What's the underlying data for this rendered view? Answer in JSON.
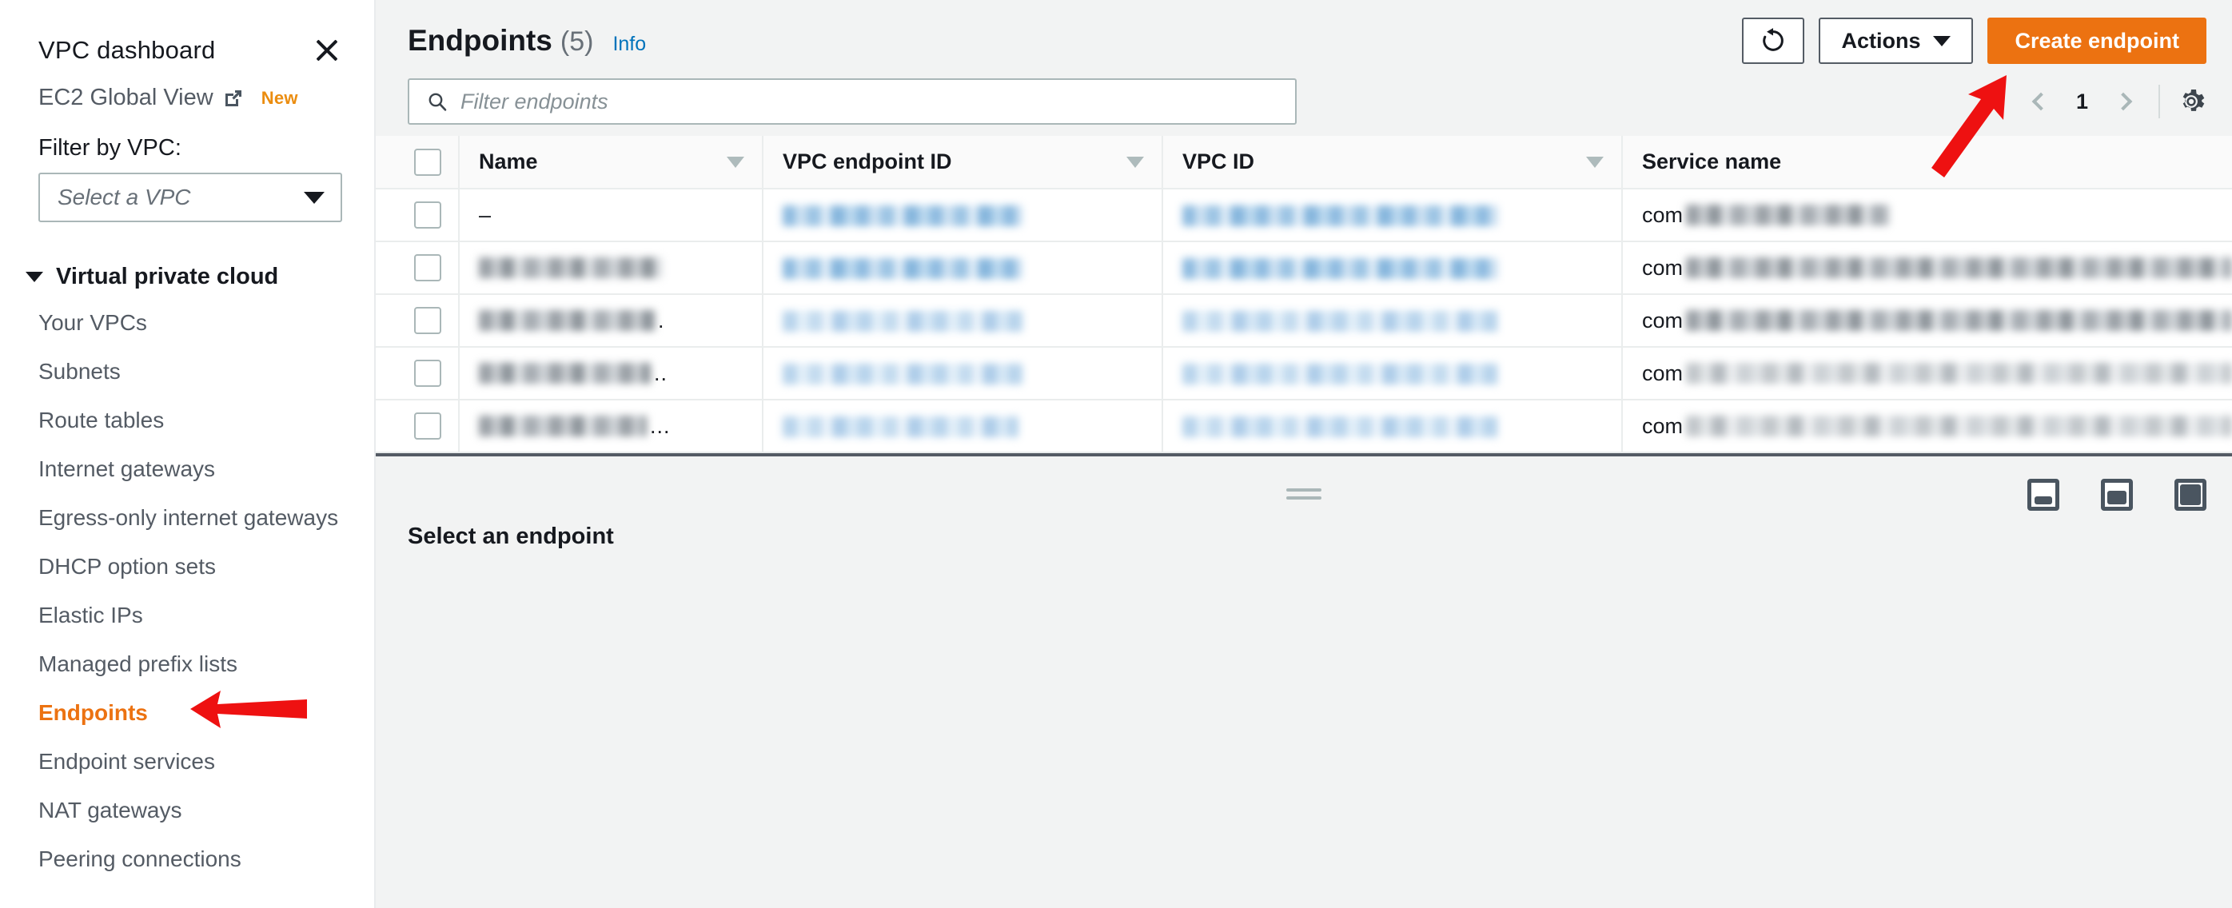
{
  "sidebar": {
    "title": "VPC dashboard",
    "close_icon": "close-icon",
    "global_view": {
      "label": "EC2 Global View",
      "external_icon": "external-link-icon",
      "badge": "New"
    },
    "filter_label": "Filter by VPC:",
    "vpc_select_placeholder": "Select a VPC",
    "group_label": "Virtual private cloud",
    "items": [
      {
        "label": "Your VPCs",
        "active": false
      },
      {
        "label": "Subnets",
        "active": false
      },
      {
        "label": "Route tables",
        "active": false
      },
      {
        "label": "Internet gateways",
        "active": false
      },
      {
        "label": "Egress-only internet gateways",
        "active": false
      },
      {
        "label": "DHCP option sets",
        "active": false
      },
      {
        "label": "Elastic IPs",
        "active": false
      },
      {
        "label": "Managed prefix lists",
        "active": false
      },
      {
        "label": "Endpoints",
        "active": true
      },
      {
        "label": "Endpoint services",
        "active": false
      },
      {
        "label": "NAT gateways",
        "active": false
      },
      {
        "label": "Peering connections",
        "active": false
      }
    ]
  },
  "header": {
    "title": "Endpoints",
    "count": "(5)",
    "info_link": "Info",
    "refresh_icon": "refresh-icon",
    "actions_label": "Actions",
    "create_label": "Create endpoint"
  },
  "search": {
    "icon": "search-icon",
    "placeholder": "Filter endpoints"
  },
  "pagination": {
    "prev_icon": "chevron-left-icon",
    "page": "1",
    "next_icon": "chevron-right-icon",
    "settings_icon": "gear-icon"
  },
  "table": {
    "columns": [
      {
        "label": "Name",
        "sortable": true
      },
      {
        "label": "VPC endpoint ID",
        "sortable": true
      },
      {
        "label": "VPC ID",
        "sortable": true
      },
      {
        "label": "Service name",
        "sortable": false
      }
    ],
    "rows": [
      {
        "name": "–",
        "name_redacted": false,
        "name_width": 0,
        "vpce_width": 300,
        "vpce_shade": "blue",
        "vpcid_width": 395,
        "vpcid_shade": "blue",
        "service_prefix": "com",
        "service_width": 255,
        "service_shade": "gray",
        "name_suffix": ""
      },
      {
        "name": "",
        "name_redacted": true,
        "name_width": 230,
        "vpce_width": 300,
        "vpce_shade": "blue",
        "vpcid_width": 395,
        "vpcid_shade": "blue",
        "service_prefix": "com",
        "service_width": 1560,
        "service_shade": "gray",
        "name_suffix": ""
      },
      {
        "name": "",
        "name_redacted": true,
        "name_width": 220,
        "vpce_width": 300,
        "vpce_shade": "blue-light",
        "vpcid_width": 395,
        "vpcid_shade": "blue-light",
        "service_prefix": "com",
        "service_width": 1560,
        "service_shade": "gray",
        "name_suffix": "."
      },
      {
        "name": "",
        "name_redacted": true,
        "name_width": 215,
        "vpce_width": 300,
        "vpce_shade": "blue-light",
        "vpcid_width": 395,
        "vpcid_shade": "blue-light",
        "service_prefix": "com",
        "service_width": 1560,
        "service_shade": "gray-light",
        "name_suffix": ".."
      },
      {
        "name": "",
        "name_redacted": true,
        "name_width": 210,
        "vpce_width": 295,
        "vpce_shade": "blue-light",
        "vpcid_width": 395,
        "vpcid_shade": "blue-light",
        "service_prefix": "com",
        "service_width": 1560,
        "service_shade": "gray-light",
        "name_suffix": "..."
      }
    ]
  },
  "split_panel": {
    "title": "Select an endpoint",
    "resize_handle": "resize-handle",
    "layout_icons": [
      "panel-size-small-icon",
      "panel-size-medium-icon",
      "panel-size-large-icon"
    ]
  },
  "annotations": {
    "arrow_color": "#ee1111",
    "arrow_sidebar_target": "Endpoints",
    "arrow_create_target": "Create endpoint"
  },
  "colors": {
    "accent_orange": "#ec7211",
    "link_blue": "#0073bb",
    "text_dark": "#16191f",
    "text_muted": "#545b64",
    "bg_gray": "#f2f3f3",
    "border": "#aab7b8"
  }
}
